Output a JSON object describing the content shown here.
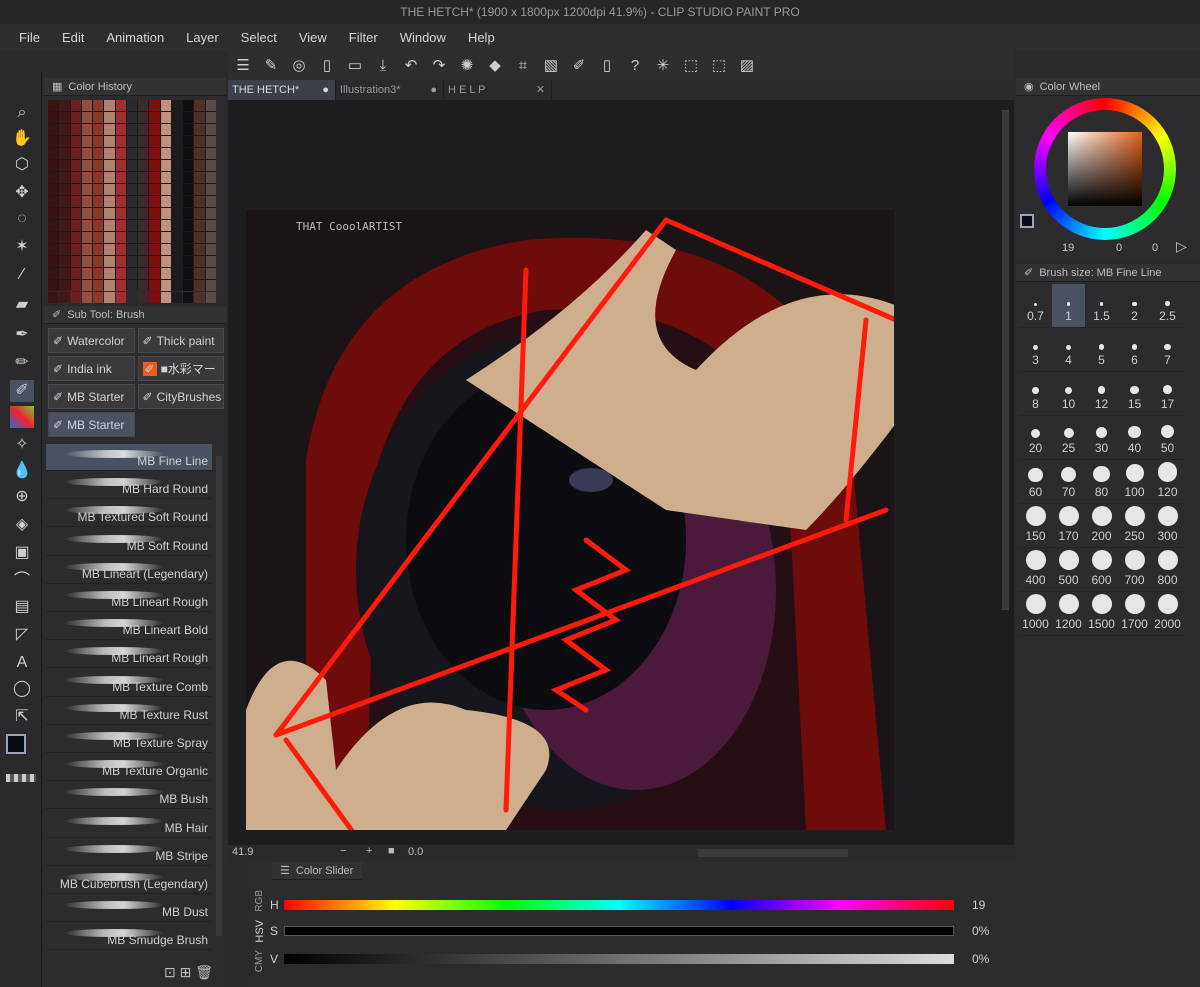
{
  "window": {
    "title": "THE HETCH* (1900 x 1800px 1200dpi 41.9%)  - CLIP STUDIO PAINT PRO"
  },
  "menu": [
    "File",
    "Edit",
    "Animation",
    "Layer",
    "Select",
    "View",
    "Filter",
    "Window",
    "Help"
  ],
  "doc_tabs": [
    {
      "label": "THE HETCH*",
      "active": true
    },
    {
      "label": "Illustration3*",
      "active": false
    },
    {
      "label": "H E L P",
      "active": false
    }
  ],
  "panels": {
    "color_history": "Color History",
    "sub_tool": "Sub Tool: Brush",
    "color_wheel": "Color Wheel",
    "brush_size": "Brush size: MB Fine Line",
    "color_slider": "Color Slider"
  },
  "sub_tool_tabs": [
    "Watercolor",
    "Thick paint",
    "India ink",
    "■水彩マー",
    "MB Starter",
    "CityBrushes",
    "MB Starter"
  ],
  "brushes": [
    "MB Fine Line",
    "MB Hard Round",
    "MB Textured Soft Round",
    "MB Soft Round",
    "MB Lineart (Legendary)",
    "MB Lineart Rough",
    "MB Lineart Bold",
    "MB Lineart Rough",
    "MB Texture Comb",
    "MB Texture Rust",
    "MB Texture Spray",
    "MB Texture Organic",
    "MB Bush",
    "MB Hair",
    "MB Stripe",
    "MB Cubebrush (Legendary)",
    "MB Dust",
    "MB Smudge Brush"
  ],
  "brush_sizes": [
    "0.7",
    "1",
    "1.5",
    "2",
    "2.5",
    "3",
    "4",
    "5",
    "6",
    "7",
    "8",
    "10",
    "12",
    "15",
    "17",
    "20",
    "25",
    "30",
    "40",
    "50",
    "60",
    "70",
    "80",
    "100",
    "120",
    "150",
    "170",
    "200",
    "250",
    "300",
    "400",
    "500",
    "600",
    "700",
    "800",
    "1000",
    "1200",
    "1500",
    "1700",
    "2000"
  ],
  "selected_brush_size": "1",
  "status": {
    "zoom": "41.9",
    "rotation": "0.0"
  },
  "color_wheel_values": {
    "h": "19",
    "s": "0",
    "v": "0"
  },
  "color_slider": {
    "mode_tabs": [
      "RGB",
      "HSV",
      "CMY"
    ],
    "rows": [
      {
        "label": "H",
        "value": "19"
      },
      {
        "label": "S",
        "value": "0%"
      },
      {
        "label": "V",
        "value": "0%"
      }
    ]
  },
  "artwork": {
    "signature": "THAT CooolARTIST"
  },
  "colors": {
    "accent": "#4a5160",
    "string_red": "#ff1a0a",
    "hood_red": "#7a0c0c"
  }
}
